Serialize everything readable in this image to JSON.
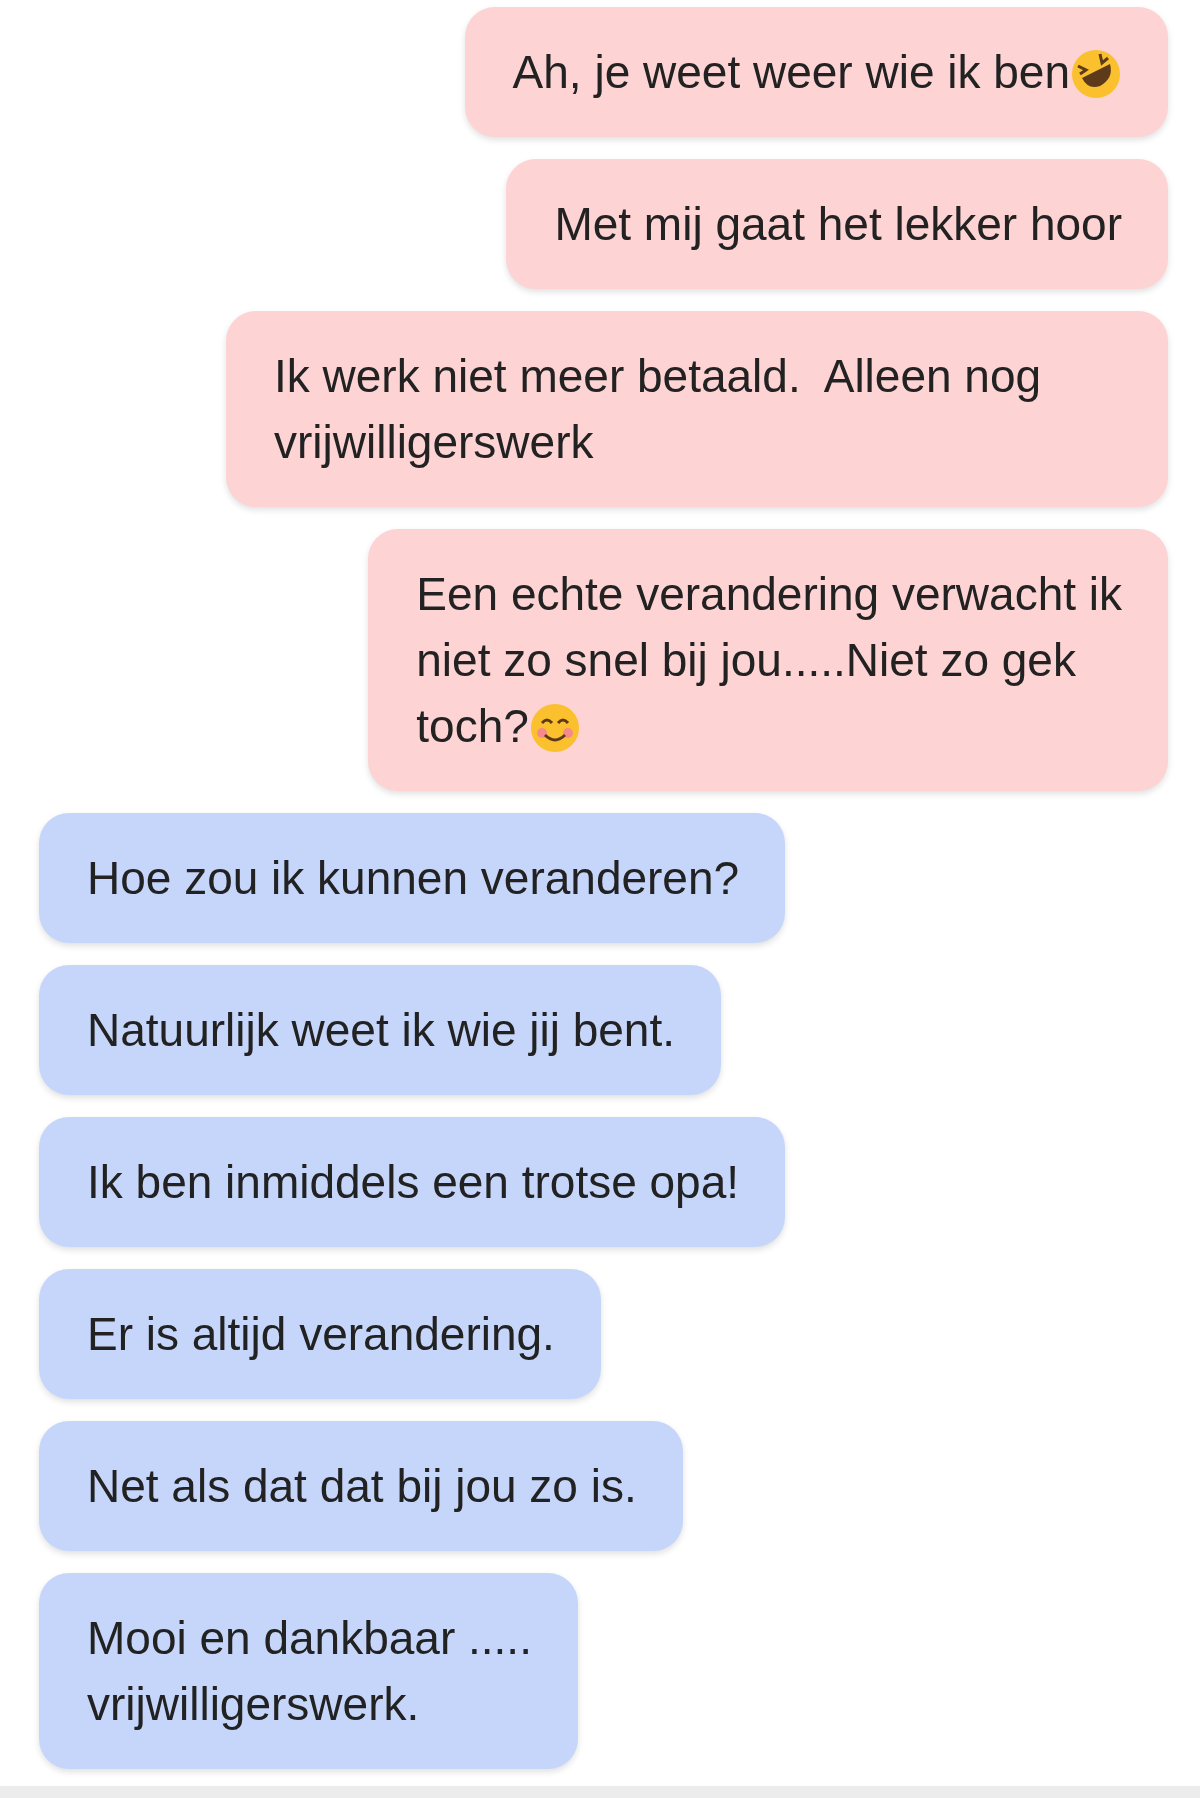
{
  "messages": [
    {
      "kind": "sent",
      "text": "Ah, je weet weer wie ik ben",
      "emoji": {
        "kind": "laughing"
      }
    },
    {
      "kind": "sent",
      "text": "Met mij gaat het lekker hoor"
    },
    {
      "kind": "sent",
      "text": "Ik werk niet meer betaald.  Alleen nog vrijwilligerswerk"
    },
    {
      "kind": "sent",
      "text": "Een echte verandering verwacht ik\nniet zo snel bij jou.....Niet zo gek\ntoch?",
      "emoji": {
        "kind": "smiling"
      }
    },
    {
      "kind": "received",
      "text": "Hoe zou ik kunnen veranderen?"
    },
    {
      "kind": "received",
      "text": "Natuurlijk weet ik wie jij bent."
    },
    {
      "kind": "received",
      "text": "Ik ben inmiddels een trotse opa!"
    },
    {
      "kind": "received",
      "text": "Er is altijd verandering."
    },
    {
      "kind": "received",
      "text": "Net als dat dat bij jou zo is."
    },
    {
      "kind": "received",
      "text": "Mooi en dankbaar .....\nvrijwilligerswerk."
    }
  ]
}
